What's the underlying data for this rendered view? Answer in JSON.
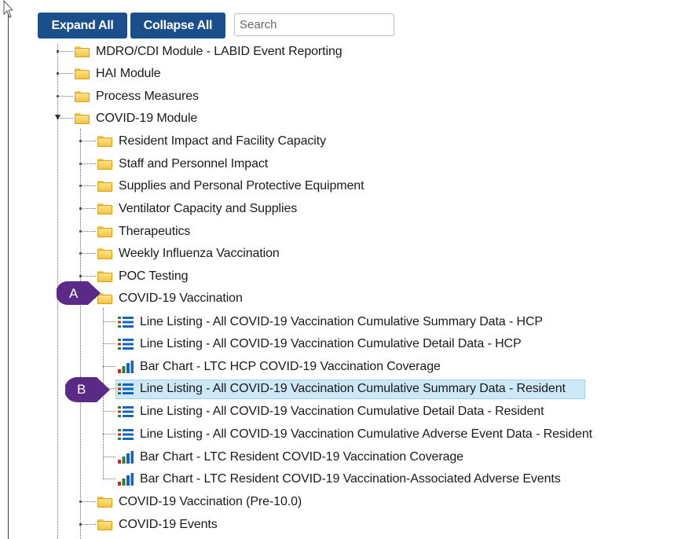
{
  "toolbar": {
    "expand_label": "Expand All",
    "collapse_label": "Collapse All",
    "search_placeholder": "Search"
  },
  "tree": {
    "top_level": [
      "MDRO/CDI Module - LABID Event Reporting",
      "HAI Module",
      "Process Measures",
      "COVID-19 Module"
    ],
    "covid_module": [
      "Resident Impact and Facility Capacity",
      "Staff and Personnel Impact",
      "Supplies and Personal Protective Equipment",
      "Ventilator Capacity and Supplies",
      "Therapeutics",
      "Weekly Influenza Vaccination",
      "POC Testing",
      "COVID-19 Vaccination",
      "COVID-19 Vaccination (Pre-10.0)",
      "COVID-19 Events"
    ],
    "vaccination_reports": [
      "Line Listing - All COVID-19 Vaccination Cumulative Summary Data - HCP",
      "Line Listing - All COVID-19 Vaccination Cumulative Detail Data - HCP",
      "Bar Chart - LTC HCP COVID-19 Vaccination Coverage",
      "Line Listing - All COVID-19 Vaccination Cumulative Summary Data - Resident",
      "Line Listing - All COVID-19 Vaccination Cumulative Detail Data - Resident",
      "Line Listing - All COVID-19 Vaccination Cumulative Adverse Event Data - Resident",
      "Bar Chart - LTC Resident COVID-19 Vaccination Coverage",
      "Bar Chart - LTC Resident COVID-19 Vaccination-Associated Adverse Events"
    ],
    "report_icons": [
      "list-icon",
      "list-icon",
      "bar-chart-icon",
      "list-icon",
      "list-icon",
      "list-icon",
      "bar-chart-icon",
      "bar-chart-icon"
    ],
    "selected_report": "Line Listing - All COVID-19 Vaccination Cumulative Summary Data - Resident"
  },
  "callouts": {
    "a": "A",
    "b": "B"
  },
  "colors": {
    "button": "#1a4f8c",
    "badge": "#5b2a86",
    "selection": "#cde8f7",
    "folder": "#f5c542"
  }
}
